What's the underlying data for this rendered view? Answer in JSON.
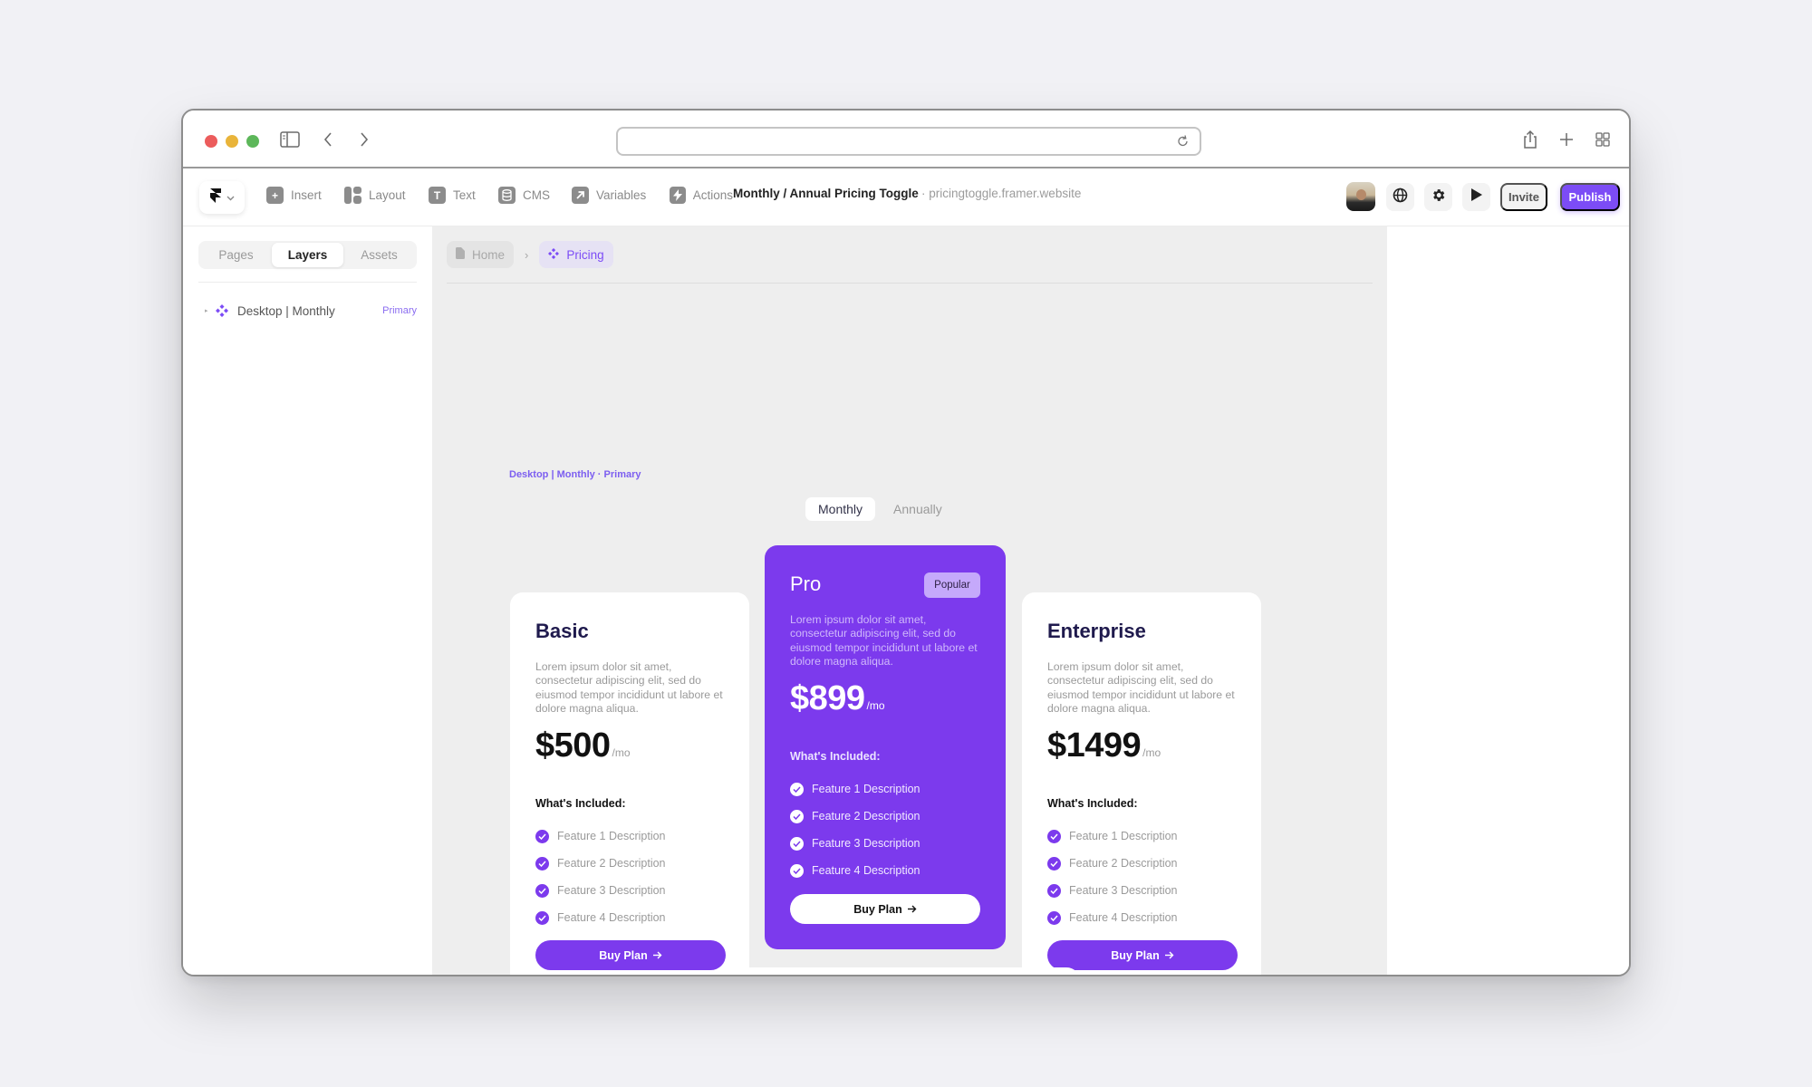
{
  "browser": {
    "url_value": "",
    "icons": {
      "sidebar": "sidebar-toggle-icon",
      "back": "chevron-left-icon",
      "forward": "chevron-right-icon",
      "reload": "reload-icon",
      "share": "share-icon",
      "new_tab": "plus-icon",
      "tab_overview": "grid-icon"
    }
  },
  "toolbar": {
    "tools": [
      {
        "label": "Insert",
        "icon": "plus-square-icon"
      },
      {
        "label": "Layout",
        "icon": "layout-icon"
      },
      {
        "label": "Text",
        "icon": "text-icon"
      },
      {
        "label": "CMS",
        "icon": "database-icon"
      },
      {
        "label": "Variables",
        "icon": "arrow-up-right-icon"
      },
      {
        "label": "Actions",
        "icon": "lightning-icon"
      }
    ],
    "project_title": "Monthly / Annual Pricing Toggle",
    "project_url": "· pricingtoggle.framer.website",
    "invite_label": "Invite",
    "publish_label": "Publish"
  },
  "sidebar": {
    "tabs": [
      {
        "label": "Pages",
        "active": false
      },
      {
        "label": "Layers",
        "active": true
      },
      {
        "label": "Assets",
        "active": false
      }
    ],
    "layers": [
      {
        "name": "Desktop | Monthly",
        "tag": "Primary"
      }
    ]
  },
  "canvas": {
    "breadcrumb": [
      {
        "label": "Home",
        "icon": "page-icon"
      },
      {
        "label": "Pricing",
        "icon": "component-icon"
      }
    ],
    "frame_label": "Desktop | Monthly · Primary",
    "billing_toggle": {
      "options": [
        "Monthly",
        "Annually"
      ],
      "selected": "Monthly"
    },
    "plans": [
      {
        "name": "Basic",
        "badge": null,
        "description": "Lorem ipsum dolor sit amet, consectetur adipiscing elit, sed do eiusmod tempor incididunt ut labore et dolore magna aliqua.",
        "price": "$500",
        "period": "/mo",
        "included_label": "What's Included:",
        "features": [
          "Feature 1 Description",
          "Feature 2 Description",
          "Feature 3 Description",
          "Feature 4 Description"
        ],
        "cta": "Buy Plan"
      },
      {
        "name": "Pro",
        "badge": "Popular",
        "description": "Lorem ipsum dolor sit amet, consectetur adipiscing elit, sed do eiusmod tempor incididunt ut labore et dolore magna aliqua.",
        "price": "$899",
        "period": "/mo",
        "included_label": "What's Included:",
        "features": [
          "Feature 1 Description",
          "Feature 2 Description",
          "Feature 3 Description",
          "Feature 4 Description"
        ],
        "cta": "Buy Plan"
      },
      {
        "name": "Enterprise",
        "badge": null,
        "description": "Lorem ipsum dolor sit amet, consectetur adipiscing elit, sed do eiusmod tempor incididunt ut labore et dolore magna aliqua.",
        "price": "$1499",
        "period": "/mo",
        "included_label": "What's Included:",
        "features": [
          "Feature 1 Description",
          "Feature 2 Description",
          "Feature 3 Description",
          "Feature 4 Description"
        ],
        "cta": "Buy Plan"
      }
    ]
  },
  "colors": {
    "accent": "#7c3aed",
    "publish": "#7c4cf6",
    "popular_badge": "#c5a9fb",
    "traffic_red": "#ec5c5c",
    "traffic_yellow": "#e9b43a",
    "traffic_green": "#5db75a"
  }
}
